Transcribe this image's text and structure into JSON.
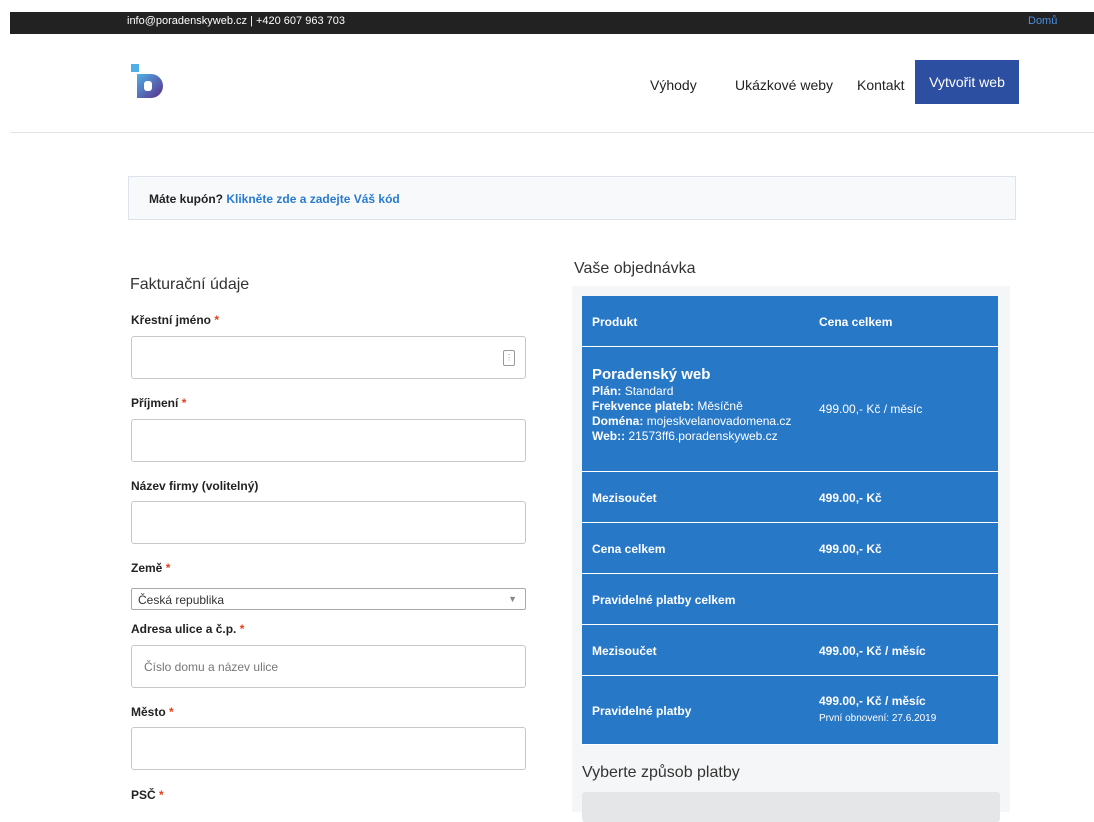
{
  "topbar": {
    "contact": "info@poradenskyweb.cz | +420 607 963 703",
    "home_link": "Domů"
  },
  "nav": {
    "items": [
      "Výhody",
      "Ukázkové weby",
      "Kontakt"
    ],
    "cta": "Vytvořit web"
  },
  "coupon": {
    "question": "Máte kupón?",
    "link": "Klikněte zde a zadejte Váš kód"
  },
  "billing": {
    "title": "Fakturační údaje",
    "required_mark": "*",
    "first_name_label": "Křestní jméno",
    "last_name_label": "Příjmení",
    "company_label": "Název firmy (volitelný)",
    "country_label": "Země",
    "country_value": "Česká republika",
    "street_label": "Adresa ulice a č.p.",
    "street_placeholder": "Číslo domu a název ulice",
    "city_label": "Město",
    "zip_label": "PSČ"
  },
  "order": {
    "title": "Vaše objednávka",
    "headers": [
      "Produkt",
      "Cena celkem"
    ],
    "product": {
      "name": "Poradenský web",
      "plan_label": "Plán:",
      "plan": "Standard",
      "freq_label": "Frekvence plateb:",
      "freq": "Měsíčně",
      "domain_label": "Doména:",
      "domain": "mojeskvelanovadomena.cz",
      "web_label": "Web::",
      "web": "21573ff6.poradenskyweb.cz",
      "price": "499.00,- Kč / měsíc"
    },
    "subtotal_label": "Mezisoučet",
    "subtotal": "499.00,- Kč",
    "total_label": "Cena celkem",
    "total": "499.00,- Kč",
    "recurring_header": "Pravidelné platby celkem",
    "recurring_subtotal_label": "Mezisoučet",
    "recurring_subtotal": "499.00,- Kč / měsíc",
    "recurring_label": "Pravidelné platby",
    "recurring": "499.00,- Kč / měsíc",
    "renewal": "První obnovení: 27.6.2019"
  },
  "payment": {
    "title": "Vyberte způsob platby"
  }
}
